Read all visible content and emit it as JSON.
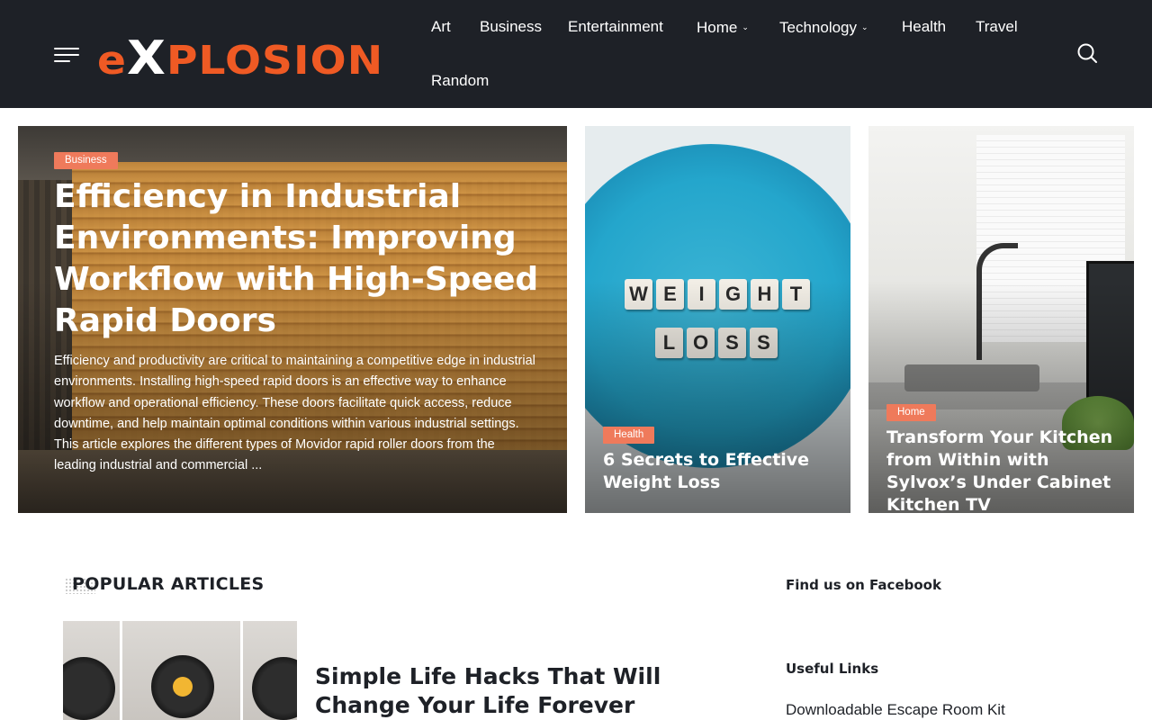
{
  "header": {
    "logo_text_pre": "e",
    "logo_text_x": "X",
    "logo_text_post": "PLOSION",
    "nav": [
      {
        "label": "Art",
        "has_dropdown": false
      },
      {
        "label": "Business",
        "has_dropdown": false
      },
      {
        "label": "Entertainment",
        "has_dropdown": false
      },
      {
        "label": "Home",
        "has_dropdown": true
      },
      {
        "label": "Technology",
        "has_dropdown": true
      },
      {
        "label": "Health",
        "has_dropdown": false
      },
      {
        "label": "Travel",
        "has_dropdown": false
      },
      {
        "label": "Random",
        "has_dropdown": false
      }
    ],
    "dropdown_glyph": "⌄"
  },
  "hero": {
    "main": {
      "category": "Business",
      "title": "Efficiency in Industrial Environments: Improving Workflow with High-Speed Rapid Doors",
      "excerpt": "Efficiency and productivity are critical to maintaining a competitive edge in industrial environments. Installing high-speed rapid doors is an effective way to enhance workflow and operational efficiency. These doors facilitate quick access, reduce downtime, and help maintain optimal conditions within various industrial settings. This article explores the different types of Movidor rapid roller doors from the leading industrial and commercial ..."
    },
    "second": {
      "category": "Health",
      "title": "6 Secrets to Effective Weight Loss",
      "tiles_row1": [
        "W",
        "E",
        "I",
        "G",
        "H",
        "T"
      ],
      "tiles_row2": [
        "L",
        "O",
        "S",
        "S"
      ]
    },
    "third": {
      "category": "Home",
      "title": "Transform Your Kitchen from Within with Sylvox’s Under Cabinet Kitchen TV"
    }
  },
  "popular": {
    "heading": "POPULAR ARTICLES",
    "first_article_title": "Simple Life Hacks That Will Change Your Life Forever"
  },
  "sidebar": {
    "facebook_heading": "Find us on Facebook",
    "useful_links_heading": "Useful Links",
    "links": [
      "Downloadable Escape Room Kit"
    ]
  },
  "colors": {
    "header_bg": "#1e2127",
    "accent": "#ef5a24",
    "badge": "#ef7a5b",
    "text_dark": "#1e2127"
  },
  "icons": {
    "menu": "hamburger-icon",
    "search": "search-icon",
    "chevron": "chevron-down-icon"
  }
}
